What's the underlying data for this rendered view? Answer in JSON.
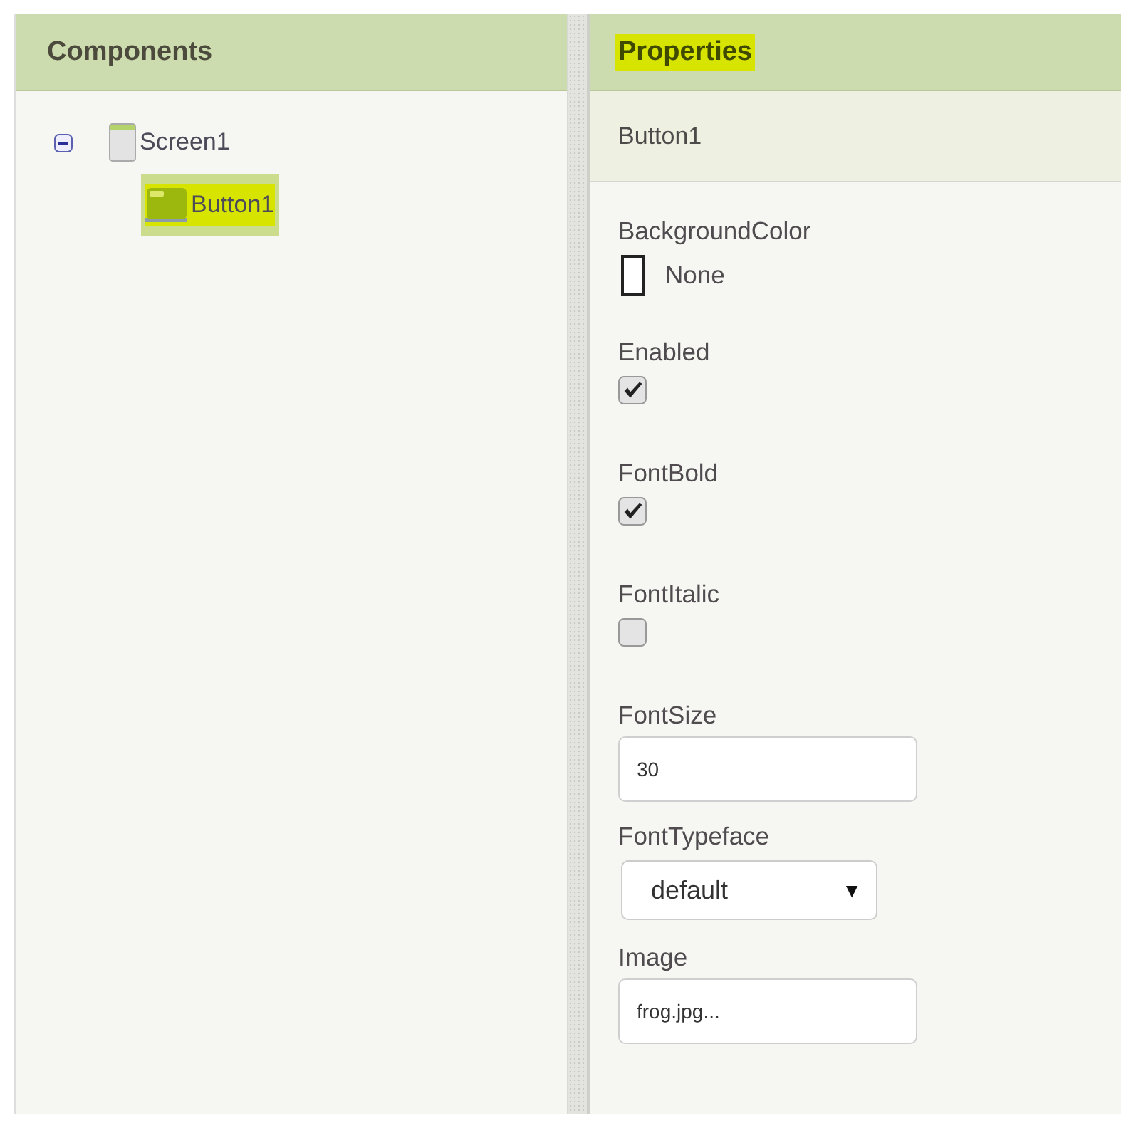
{
  "components": {
    "title": "Components",
    "tree": [
      {
        "label": "Screen1",
        "kind": "screen",
        "expanded": true,
        "selected": false,
        "children": [
          {
            "label": "Button1",
            "kind": "button",
            "selected": true
          }
        ]
      }
    ]
  },
  "properties": {
    "title": "Properties",
    "title_highlighted": true,
    "component": "Button1",
    "items": [
      {
        "label": "BackgroundColor",
        "kind": "color",
        "value": "None",
        "color": "#ffffff"
      },
      {
        "label": "Enabled",
        "kind": "checkbox",
        "checked": true
      },
      {
        "label": "FontBold",
        "kind": "checkbox",
        "checked": true
      },
      {
        "label": "FontItalic",
        "kind": "checkbox",
        "checked": false
      },
      {
        "label": "FontSize",
        "kind": "textbox",
        "value": "30"
      },
      {
        "label": "FontTypeface",
        "kind": "dropdown",
        "value": "default",
        "arrow": "▼"
      },
      {
        "label": "Image",
        "kind": "asset",
        "value": "frog.jpg..."
      }
    ]
  }
}
